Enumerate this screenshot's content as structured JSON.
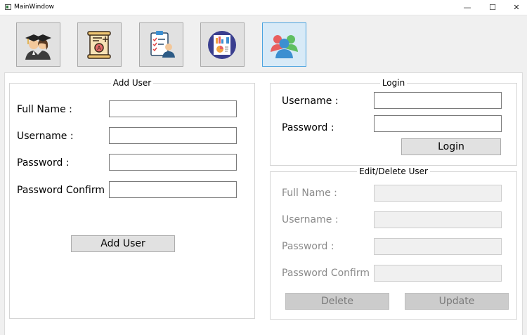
{
  "window": {
    "title": "MainWindow",
    "minimize": "—",
    "maximize": "☐",
    "close": "✕"
  },
  "toolbar": [
    {
      "icon": "graduates-icon",
      "active": false
    },
    {
      "icon": "certificate-scroll-icon",
      "active": false
    },
    {
      "icon": "clipboard-checklist-person-icon",
      "active": false
    },
    {
      "icon": "report-dashboard-icon",
      "active": false
    },
    {
      "icon": "users-group-icon",
      "active": true
    }
  ],
  "add_user": {
    "title": "Add User",
    "full_name_label": "Full Name :",
    "username_label": "Username :",
    "password_label": "Password :",
    "password_confirm_label": "Password Confirm :",
    "full_name_value": "",
    "username_value": "",
    "password_value": "",
    "password_confirm_value": "",
    "button": "Add User"
  },
  "login": {
    "title": "Login",
    "username_label": "Username :",
    "password_label": "Password :",
    "username_value": "",
    "password_value": "",
    "button": "Login"
  },
  "edit_delete": {
    "title": "Edit/Delete User",
    "full_name_label": "Full Name :",
    "username_label": "Username :",
    "password_label": "Password :",
    "password_confirm_label": "Password Confirm :",
    "delete_button": "Delete",
    "update_button": "Update",
    "enabled": false
  },
  "colors": {
    "active_border": "#4aa3df",
    "disabled_text": "#8a8a8a"
  }
}
